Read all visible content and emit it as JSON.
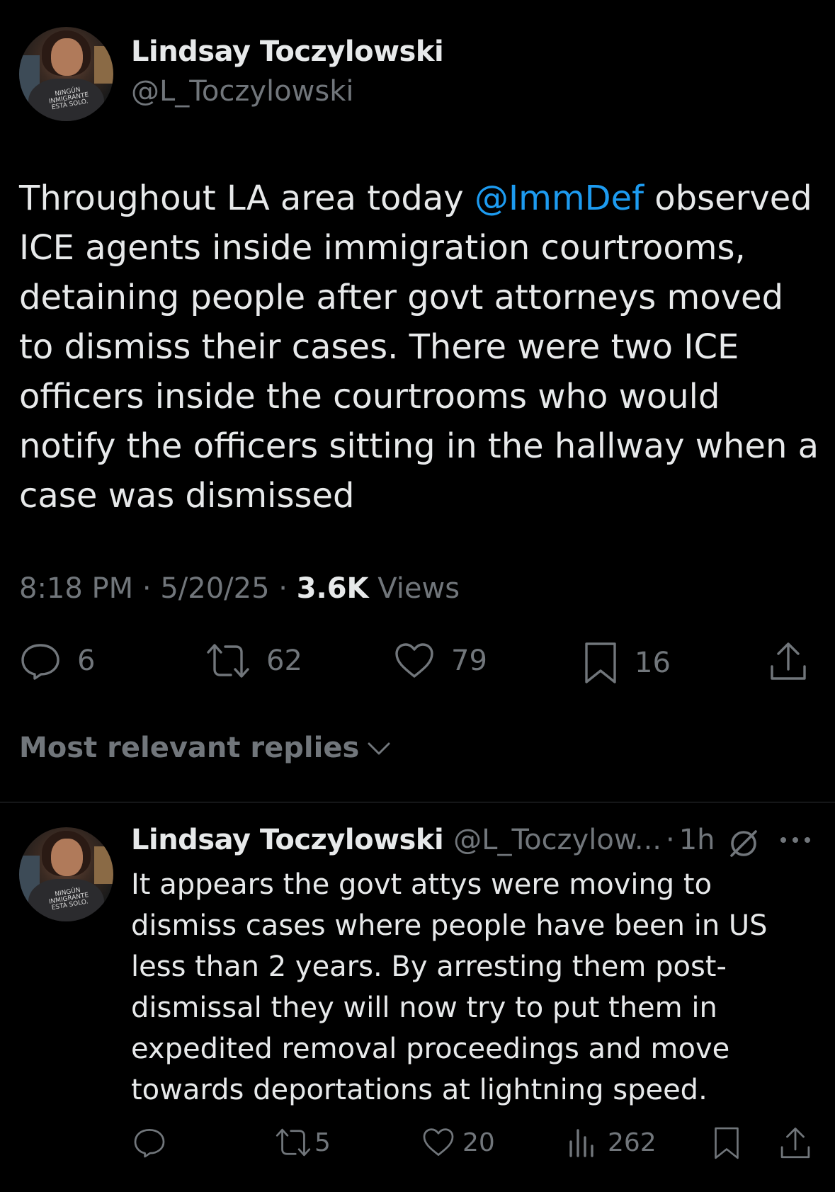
{
  "tweet": {
    "author_name": "Lindsay Toczylowski",
    "author_handle": "@L_Toczylowski",
    "avatar_shirt_text": "NINGÚN INMIGRANTE ESTÁ SOLO.",
    "text_before_mention": "Throughout LA area today ",
    "mention": "@ImmDef",
    "text_after_mention": " observed ICE agents inside immigration courtrooms, detaining people after govt attorneys moved to dismiss their cases. There were two ICE officers inside the courtrooms who would notify the officers sitting in the hallway when a case was dismissed",
    "time": "8:18 PM",
    "date": "5/20/25",
    "separator": "·",
    "views_count": "3.6K",
    "views_label": "Views",
    "stats": {
      "replies": "6",
      "reposts": "62",
      "likes": "79",
      "bookmarks": "16"
    },
    "icons": {
      "reply": "reply-icon",
      "repost": "repost-icon",
      "like": "heart-icon",
      "bookmark": "bookmark-icon",
      "share": "share-icon"
    }
  },
  "replies_sort": {
    "label": "Most relevant replies"
  },
  "reply": {
    "author_name": "Lindsay Toczylowski",
    "author_handle": "@L_Toczylow...",
    "separator": "·",
    "time": "1h",
    "text": "It appears the govt attys were moving to dismiss cases where people have been in US less than 2 years. By arresting them post-dismissal they will now try to put them in expedited removal proceedings and move towards deportations at lightning speed.",
    "stats": {
      "reposts": "5",
      "likes": "20",
      "views": "262"
    }
  },
  "colors": {
    "background": "#000000",
    "primary_text": "#e7e9ea",
    "secondary_text": "#71767b",
    "link": "#1d9bf0",
    "divider": "#2f3336"
  }
}
